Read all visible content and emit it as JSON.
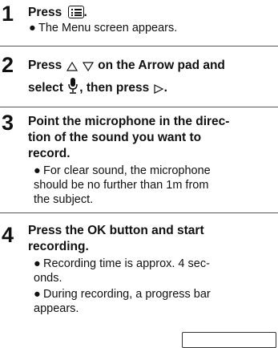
{
  "steps": [
    {
      "number": "1",
      "title_press": "Press",
      "title_after_icon": ".",
      "bullets": [
        "The Menu screen appears."
      ]
    },
    {
      "number": "2",
      "title_line1_a": "Press",
      "title_line1_b": "on the Arrow pad and",
      "title_line2_a": "select",
      "title_line2_b": ", then press",
      "title_line2_c": "."
    },
    {
      "number": "3",
      "title_lines": [
        "Point the microphone in the direc-",
        "tion of the sound you want to",
        "record."
      ],
      "bullets": [
        [
          "For clear sound, the microphone",
          "should be no further than 1m from",
          "the subject."
        ]
      ]
    },
    {
      "number": "4",
      "title_lines": [
        "Press the OK button and start",
        "recording."
      ],
      "bullets": [
        [
          "Recording time is approx. 4 sec-",
          "onds."
        ],
        [
          "During recording, a progress bar",
          "appears."
        ]
      ]
    }
  ],
  "icons": {
    "menu_key": "menu-list-icon",
    "up_arrow": "outline-up-triangle-icon",
    "down_arrow": "outline-down-triangle-icon",
    "microphone": "microphone-icon",
    "right_arrow": "outline-right-triangle-icon"
  },
  "bullet_glyph": "●"
}
